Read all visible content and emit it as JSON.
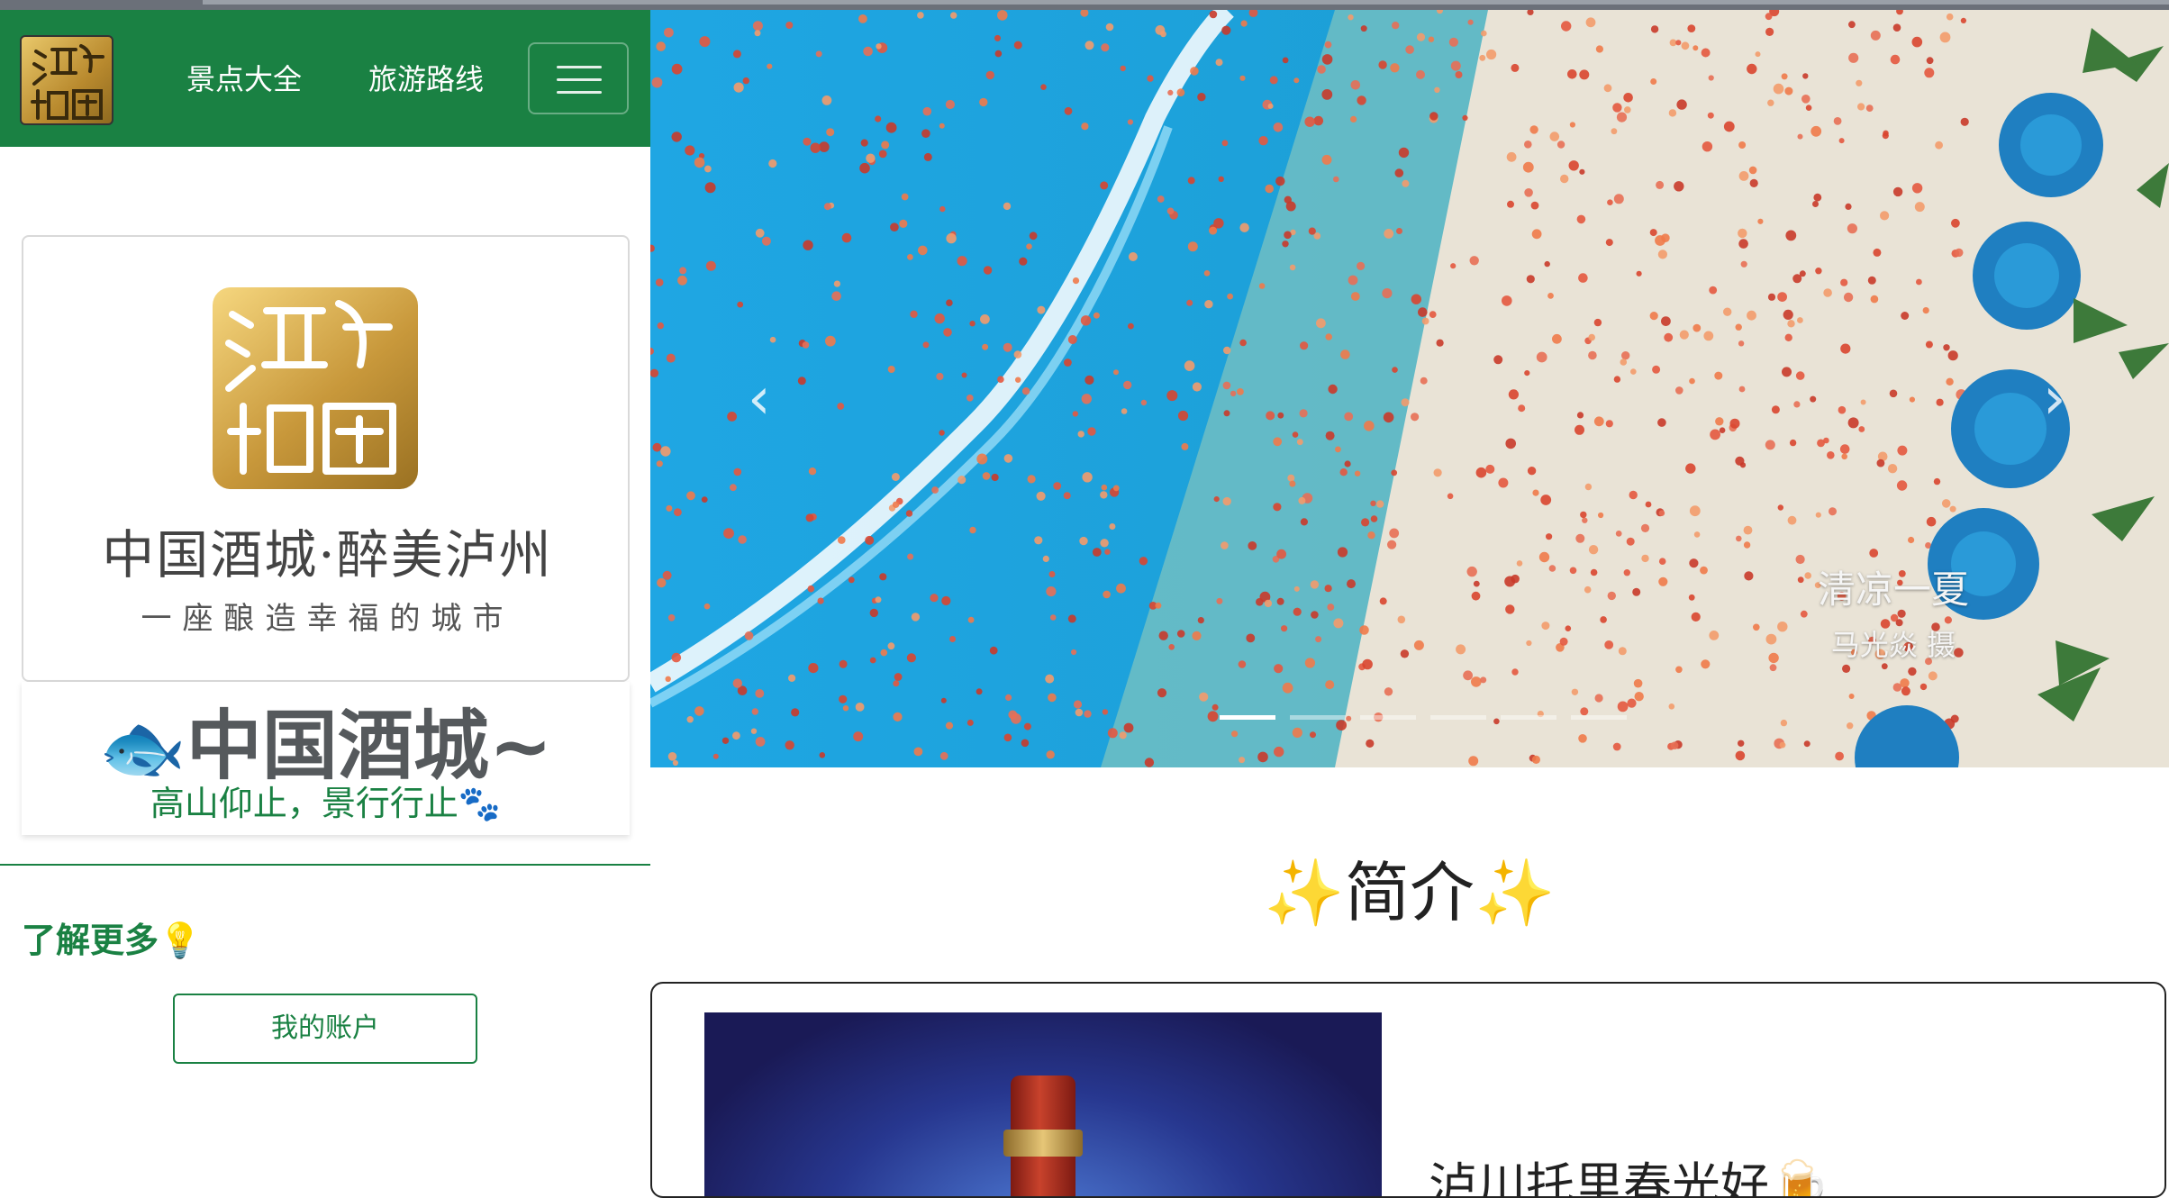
{
  "navbar": {
    "logo_icon": "jiucheng-logo",
    "links": [
      "景点大全",
      "旅游路线"
    ],
    "menu_icon": "hamburger-icon",
    "bg_color": "#1a8143"
  },
  "sidebar": {
    "brand_slogan": "中国酒城·醉美泸州",
    "brand_subslogan": "一座酿造幸福的城市",
    "title": "中国酒城~",
    "title_emoji": "🐟",
    "subtitle": "高山仰止，景行行止",
    "subtitle_emoji": "🐾",
    "learn_more": "了解更多",
    "learn_more_emoji": "💡",
    "account_button": "我的账户",
    "accent_color": "#1a8143"
  },
  "carousel": {
    "caption_title": "清凉一夏",
    "caption_sub": "马光焱 摄",
    "slide_count": 6,
    "active_index": 0,
    "prev_icon": "chevron-left-icon",
    "next_icon": "chevron-right-icon"
  },
  "intro": {
    "title": "简介",
    "sparkle_emoji": "✨",
    "card_text": "泸川托里春光好🍺"
  }
}
